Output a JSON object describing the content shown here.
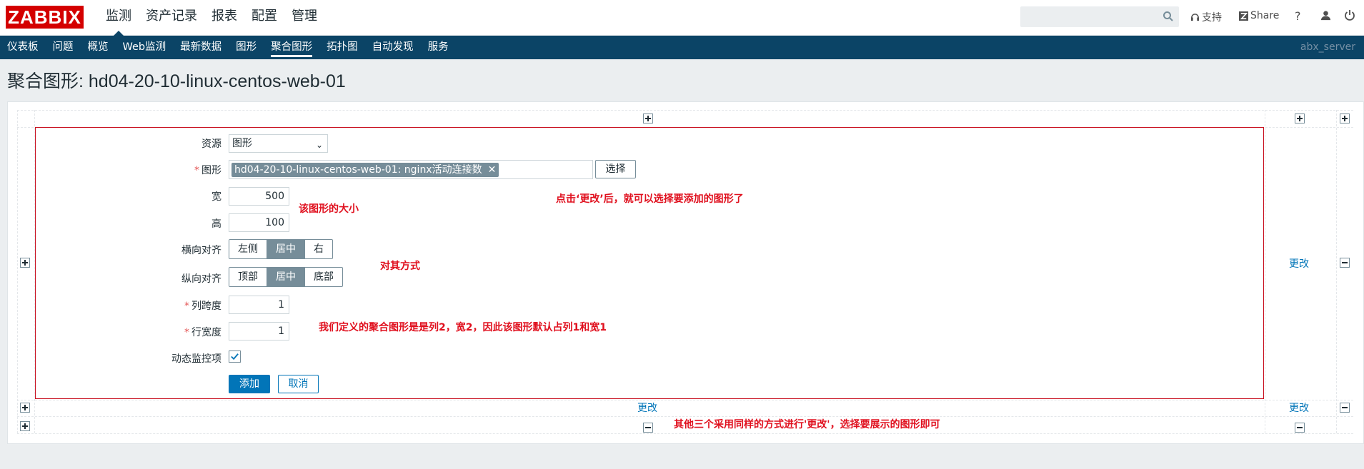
{
  "header": {
    "logo": "ZABBIX",
    "main_nav": [
      "监测",
      "资产记录",
      "报表",
      "配置",
      "管理"
    ],
    "support": "支持",
    "share": "Share",
    "help": "?"
  },
  "sub_nav": {
    "items": [
      "仪表板",
      "问题",
      "概览",
      "Web监测",
      "最新数据",
      "图形",
      "聚合图形",
      "拓扑图",
      "自动发现",
      "服务"
    ],
    "active_index": 6,
    "server": "abx_server"
  },
  "page_title": "聚合图形: hd04-20-10-linux-centos-web-01",
  "form": {
    "resource_label": "资源",
    "resource_value": "图形",
    "graph_label": "图形",
    "graph_chip": "hd04-20-10-linux-centos-web-01: nginx活动连接数",
    "select_button": "选择",
    "width_label": "宽",
    "width_value": "500",
    "height_label": "高",
    "height_value": "100",
    "halign_label": "横向对齐",
    "halign_options": [
      "左侧",
      "居中",
      "右"
    ],
    "valign_label": "纵向对齐",
    "valign_options": [
      "顶部",
      "居中",
      "底部"
    ],
    "colspan_label": "列跨度",
    "colspan_value": "1",
    "rowspan_label": "行宽度",
    "rowspan_value": "1",
    "dynamic_label": "动态监控项",
    "add_button": "添加",
    "cancel_button": "取消"
  },
  "links": {
    "change": "更改"
  },
  "annotations": {
    "size": "该图形的大小",
    "click_change": "点击‘更改’后，就可以选择要添加的图形了",
    "align": "对其方式",
    "span": "我们定义的聚合图形是是列2，宽2，因此该图形默认占列1和宽1",
    "others": "其他三个采用同样的方式进行'更改'，选择要展示的图形即可"
  },
  "colors": {
    "brand": "#d40000",
    "subnav": "#0b4466",
    "primary": "#0275b8",
    "annotation": "#e0101e"
  }
}
